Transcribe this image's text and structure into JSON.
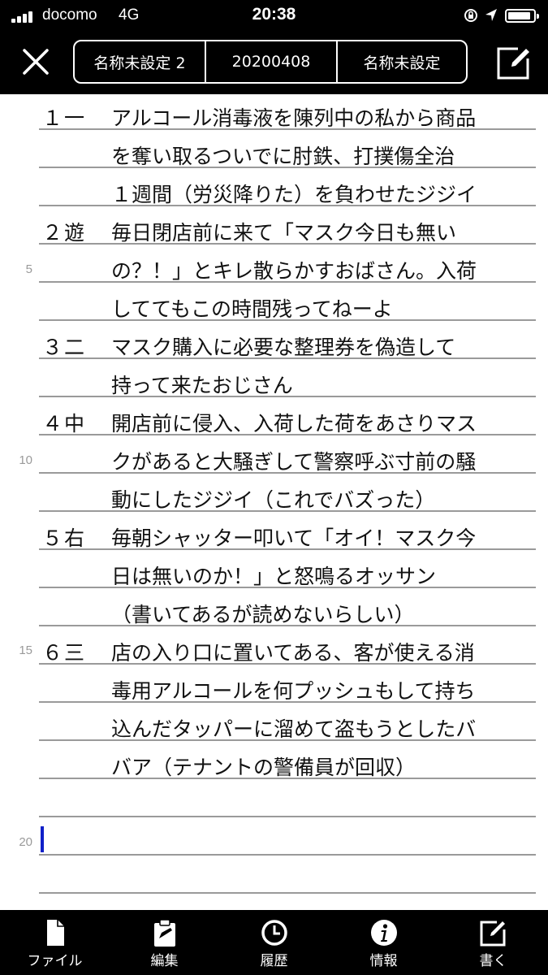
{
  "status_bar": {
    "carrier": "docomo",
    "network": "4G",
    "time": "20:38",
    "battery_level": 0.9
  },
  "header": {
    "close_icon": "close-icon",
    "segments": [
      "名称未設定 2",
      "20200408",
      "名称未設定"
    ],
    "compose_icon": "compose-icon"
  },
  "document": {
    "line_numbers": [
      "5",
      "10",
      "15",
      "20"
    ],
    "entries": [
      {
        "position": "１一",
        "lines": [
          "アルコール消毒液を陳列中の私から商品",
          "を奪い取るついでに肘鉄、打撲傷全治",
          "１週間（労災降りた）を負わせたジジイ"
        ]
      },
      {
        "position": "２遊",
        "lines": [
          "毎日閉店前に来て「マスク今日も無い",
          "の？！」とキレ散らかすおばさん。入荷",
          "しててもこの時間残ってねーよ"
        ]
      },
      {
        "position": "３二",
        "lines": [
          "マスク購入に必要な整理券を偽造して",
          "持って来たおじさん"
        ]
      },
      {
        "position": "４中",
        "lines": [
          "開店前に侵入、入荷した荷をあさりマス",
          "クがあると大騒ぎして警察呼ぶ寸前の騒",
          "動にしたジジイ（これでバズった）"
        ]
      },
      {
        "position": "５右",
        "lines": [
          "毎朝シャッター叩いて「オイ！マスク今",
          "日は無いのか！」と怒鳴るオッサン",
          "（書いてあるが読めないらしい）"
        ]
      },
      {
        "position": "６三",
        "lines": [
          "店の入り口に置いてある、客が使える消",
          "毒用アルコールを何プッシュもして持ち",
          "込んだタッパーに溜めて盗もうとしたバ",
          "バア（テナントの警備員が回収）"
        ]
      }
    ]
  },
  "tab_bar": {
    "items": [
      {
        "label": "ファイル",
        "icon": "file-icon"
      },
      {
        "label": "編集",
        "icon": "clipboard-icon"
      },
      {
        "label": "履歴",
        "icon": "clock-icon"
      },
      {
        "label": "情報",
        "icon": "info-icon"
      },
      {
        "label": "書く",
        "icon": "compose-icon"
      }
    ]
  },
  "colors": {
    "bar_background": "#000000",
    "rule_line": "#9a9a9a",
    "line_number": "#9a9a9a",
    "cursor": "#1020c8"
  }
}
